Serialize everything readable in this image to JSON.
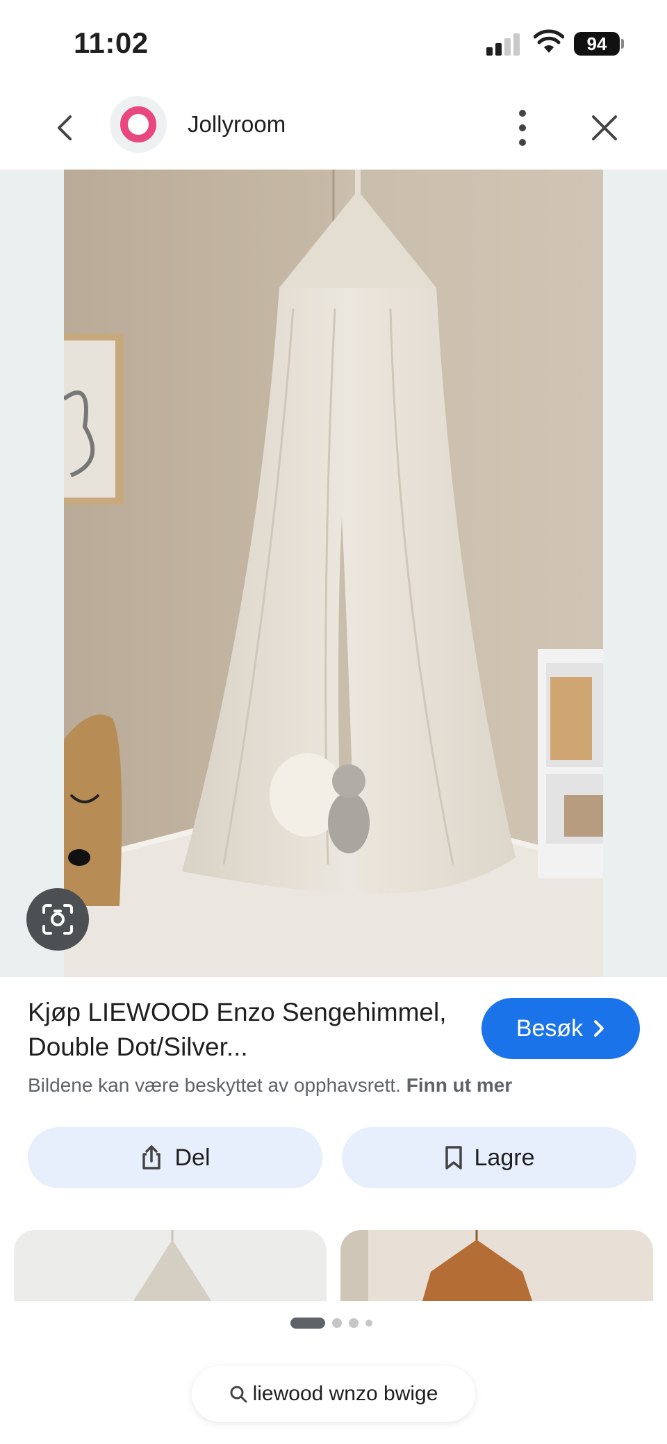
{
  "status_bar": {
    "time": "11:02",
    "battery": "94"
  },
  "header": {
    "site_name": "Jollyroom",
    "icons": {
      "back": "back-arrow-icon",
      "more": "more-vert-icon",
      "close": "close-icon",
      "logo": "jollyroom-logo"
    },
    "logo_color": "#e8487f"
  },
  "result": {
    "title": "Kjøp LIEWOOD Enzo Sengehimmel, Double Dot/Silver...",
    "visit_label": "Besøk",
    "copyright_text": "Bildene kan være beskyttet av opphavsrett.",
    "learn_more": "Finn ut mer",
    "accent": "#1a73e8"
  },
  "actions": {
    "share_label": "Del",
    "save_label": "Lagre"
  },
  "search": {
    "query": "liewood wnzo bwige"
  }
}
